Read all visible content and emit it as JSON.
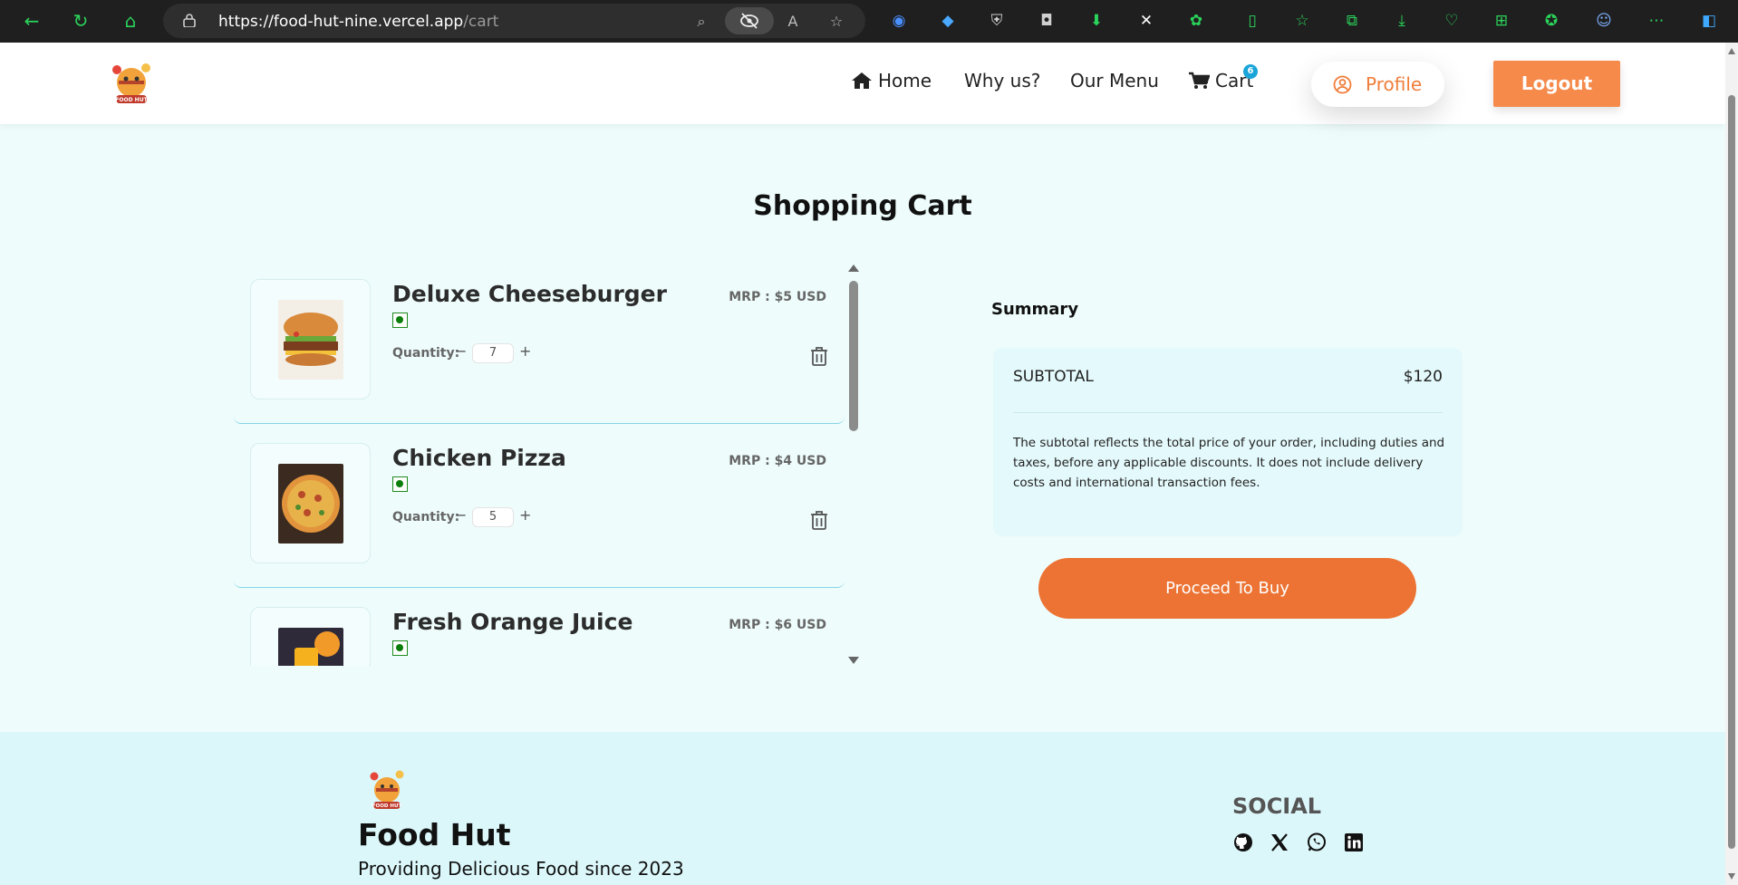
{
  "browser": {
    "url_host": "https://food-hut-nine.vercel.app",
    "url_path": "/cart"
  },
  "header": {
    "nav": {
      "home": "Home",
      "why": "Why us?",
      "menu": "Our Menu",
      "cart": "Cart",
      "cart_count": "6"
    },
    "profile_label": "Profile",
    "logout_label": "Logout"
  },
  "page": {
    "title": "Shopping Cart"
  },
  "cart": {
    "quantity_label": "Quantity:",
    "minus": "−",
    "plus": "+",
    "items": [
      {
        "name": "Deluxe Cheeseburger",
        "mrp": "MRP : $5 USD",
        "quantity": "7"
      },
      {
        "name": "Chicken Pizza",
        "mrp": "MRP : $4 USD",
        "quantity": "5"
      },
      {
        "name": "Fresh Orange Juice",
        "mrp": "MRP : $6 USD",
        "quantity": ""
      }
    ]
  },
  "summary": {
    "title": "Summary",
    "subtotal_label": "SUBTOTAL",
    "subtotal_value": "$120",
    "note": "The subtotal reflects the total price of your order, including duties and taxes, before any applicable discounts. It does not include delivery costs and international transaction fees.",
    "proceed_label": "Proceed To Buy"
  },
  "footer": {
    "brand": "Food Hut",
    "tagline": "Providing Delicious Food since 2023",
    "social_title": "SOCIAL",
    "social_icons": [
      "github-icon",
      "x-icon",
      "whatsapp-icon",
      "linkedin-icon"
    ]
  },
  "colors": {
    "accent": "#ec7333",
    "logout": "#f58a4b",
    "badge": "#1aa5d9",
    "page_bg": "#eefcfc",
    "footer_bg": "#dbf7fa"
  }
}
